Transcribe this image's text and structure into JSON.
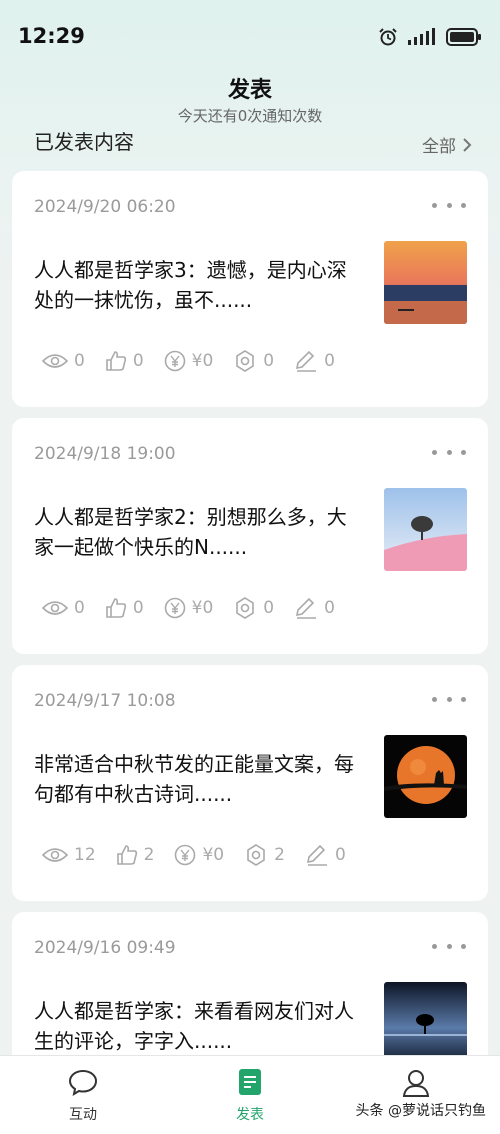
{
  "status_bar": {
    "time": "12:29"
  },
  "header": {
    "title": "发表",
    "subtitle": "今天还有0次通知次数"
  },
  "section": {
    "title": "已发表内容",
    "all_label": "全部"
  },
  "cards": [
    {
      "date": "2024/9/20 06:20",
      "text": "人人都是哲学家3：遗憾，是内心深处的一抹忧伤，虽不......",
      "stats": {
        "views": "0",
        "likes": "0",
        "reward": "¥0",
        "shares": "0",
        "comments": "0"
      }
    },
    {
      "date": "2024/9/18 19:00",
      "text": "人人都是哲学家2：别想那么多，大家一起做个快乐的N......",
      "stats": {
        "views": "0",
        "likes": "0",
        "reward": "¥0",
        "shares": "0",
        "comments": "0"
      }
    },
    {
      "date": "2024/9/17 10:08",
      "text": "非常适合中秋节发的正能量文案，每句都有中秋古诗词......",
      "stats": {
        "views": "12",
        "likes": "2",
        "reward": "¥0",
        "shares": "2",
        "comments": "0"
      }
    },
    {
      "date": "2024/9/16 09:49",
      "text": "人人都是哲学家：来看看网友们对人生的评论，字字入......"
    }
  ],
  "tabs": [
    {
      "label": "互动",
      "icon": "chat-icon"
    },
    {
      "label": "发表",
      "icon": "document-icon",
      "active": true
    },
    {
      "label": "",
      "icon": "person-icon"
    }
  ],
  "watermark": "头条 @萝说话只钓鱼",
  "colors": {
    "accent": "#22a46b"
  }
}
